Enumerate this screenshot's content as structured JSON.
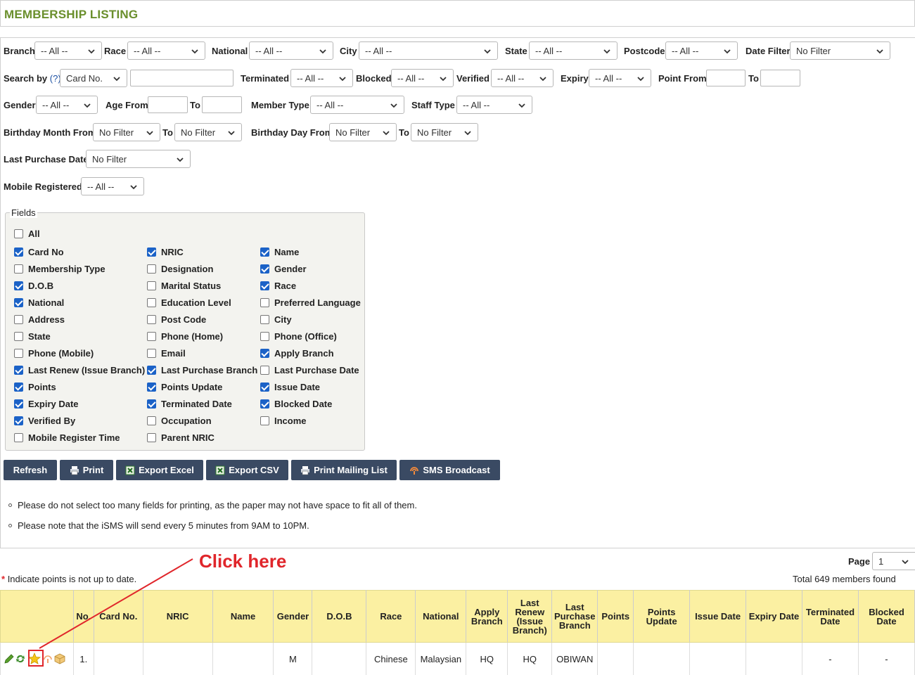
{
  "page_title": "MEMBERSHIP LISTING",
  "filters": {
    "branch": {
      "label": "Branch",
      "value": "-- All --"
    },
    "race": {
      "label": "Race",
      "value": "-- All --"
    },
    "national": {
      "label": "National",
      "value": "-- All --"
    },
    "city": {
      "label": "City",
      "value": "-- All --"
    },
    "state": {
      "label": "State",
      "value": "-- All --"
    },
    "postcode": {
      "label": "Postcode",
      "value": "-- All --"
    },
    "date_filter": {
      "label": "Date Filter",
      "value": "No Filter"
    },
    "search_by": {
      "label": "Search by",
      "help": "(?)",
      "value": "Card No.",
      "text": ""
    },
    "terminated": {
      "label": "Terminated",
      "value": "-- All --"
    },
    "blocked": {
      "label": "Blocked",
      "value": "-- All --"
    },
    "verified": {
      "label": "Verified",
      "value": "-- All --"
    },
    "expiry": {
      "label": "Expiry",
      "value": "-- All --"
    },
    "point_from": {
      "label": "Point From",
      "to_label": "To"
    },
    "gender": {
      "label": "Gender",
      "value": "-- All --"
    },
    "age_from": {
      "label": "Age From",
      "to_label": "To"
    },
    "member_type": {
      "label": "Member Type",
      "value": "-- All --"
    },
    "staff_type": {
      "label": "Staff Type",
      "value": "-- All --"
    },
    "birthday_month_from": {
      "label": "Birthday Month From",
      "value": "No Filter",
      "to_label": "To",
      "to_value": "No Filter"
    },
    "birthday_day_from": {
      "label": "Birthday Day From",
      "value": "No Filter",
      "to_label": "To",
      "to_value": "No Filter"
    },
    "last_purchase_date": {
      "label": "Last Purchase Date",
      "value": "No Filter"
    },
    "mobile_registered": {
      "label": "Mobile Registered",
      "value": "-- All --"
    }
  },
  "fields": {
    "legend": "Fields",
    "all_label": "All",
    "all_checked": false,
    "items": [
      {
        "label": "Card No",
        "checked": true
      },
      {
        "label": "NRIC",
        "checked": true
      },
      {
        "label": "Name",
        "checked": true
      },
      {
        "label": "Membership Type",
        "checked": false
      },
      {
        "label": "Designation",
        "checked": false
      },
      {
        "label": "Gender",
        "checked": true
      },
      {
        "label": "D.O.B",
        "checked": true
      },
      {
        "label": "Marital Status",
        "checked": false
      },
      {
        "label": "Race",
        "checked": true
      },
      {
        "label": "National",
        "checked": true
      },
      {
        "label": "Education Level",
        "checked": false
      },
      {
        "label": "Preferred Language",
        "checked": false
      },
      {
        "label": "Address",
        "checked": false
      },
      {
        "label": "Post Code",
        "checked": false
      },
      {
        "label": "City",
        "checked": false
      },
      {
        "label": "State",
        "checked": false
      },
      {
        "label": "Phone (Home)",
        "checked": false
      },
      {
        "label": "Phone (Office)",
        "checked": false
      },
      {
        "label": "Phone (Mobile)",
        "checked": false
      },
      {
        "label": "Email",
        "checked": false
      },
      {
        "label": "Apply Branch",
        "checked": true
      },
      {
        "label": "Last Renew (Issue Branch)",
        "checked": true
      },
      {
        "label": "Last Purchase Branch",
        "checked": true
      },
      {
        "label": "Last Purchase Date",
        "checked": false
      },
      {
        "label": "Points",
        "checked": true
      },
      {
        "label": "Points Update",
        "checked": true
      },
      {
        "label": "Issue Date",
        "checked": true
      },
      {
        "label": "Expiry Date",
        "checked": true
      },
      {
        "label": "Terminated Date",
        "checked": true
      },
      {
        "label": "Blocked Date",
        "checked": true
      },
      {
        "label": "Verified By",
        "checked": true
      },
      {
        "label": "Occupation",
        "checked": false
      },
      {
        "label": "Income",
        "checked": false
      },
      {
        "label": "Mobile Register Time",
        "checked": false
      },
      {
        "label": "Parent NRIC",
        "checked": false
      }
    ]
  },
  "buttons": {
    "refresh": "Refresh",
    "print": "Print",
    "export_excel": "Export Excel",
    "export_csv": "Export CSV",
    "print_mailing_list": "Print Mailing List",
    "sms_broadcast": "SMS Broadcast"
  },
  "notes": [
    "Please do not select too many fields for printing, as the paper may not have space to fit all of them.",
    "Please note that the iSMS will send every 5 minutes from 9AM to 10PM."
  ],
  "annotation": "Click here",
  "pagination": {
    "label": "Page",
    "value": "1"
  },
  "legend_note": {
    "asterisk": "*",
    "text": "Indicate points is not up to date."
  },
  "total_text": "Total 649 members found",
  "table": {
    "columns": [
      "No.",
      "Card No.",
      "NRIC",
      "Name",
      "Gender",
      "D.O.B",
      "Race",
      "National",
      "Apply Branch",
      "Last Renew (Issue Branch)",
      "Last Purchase Branch",
      "Points",
      "Points Update",
      "Issue Date",
      "Expiry Date",
      "Terminated Date",
      "Blocked Date"
    ],
    "rows": [
      {
        "no": "1.",
        "card_no": "",
        "nric": "",
        "name": "",
        "gender": "M",
        "dob": "",
        "race": "Chinese",
        "national": "Malaysian",
        "apply_branch": "HQ",
        "last_renew": "HQ",
        "last_purchase_branch": "OBIWAN",
        "points": "",
        "points_update": "",
        "issue_date": "",
        "expiry_date": "",
        "terminated_date": "-",
        "blocked_date": "-"
      }
    ]
  },
  "row_action_icons": [
    "edit-icon",
    "renew-icon",
    "star-icon",
    "sms-icon",
    "package-icon"
  ],
  "colors": {
    "title": "#6a8f2c",
    "button": "#3a4a63",
    "header_bg": "#fbf0a2",
    "annotation": "#e0262b",
    "checkbox": "#1b62c7"
  }
}
